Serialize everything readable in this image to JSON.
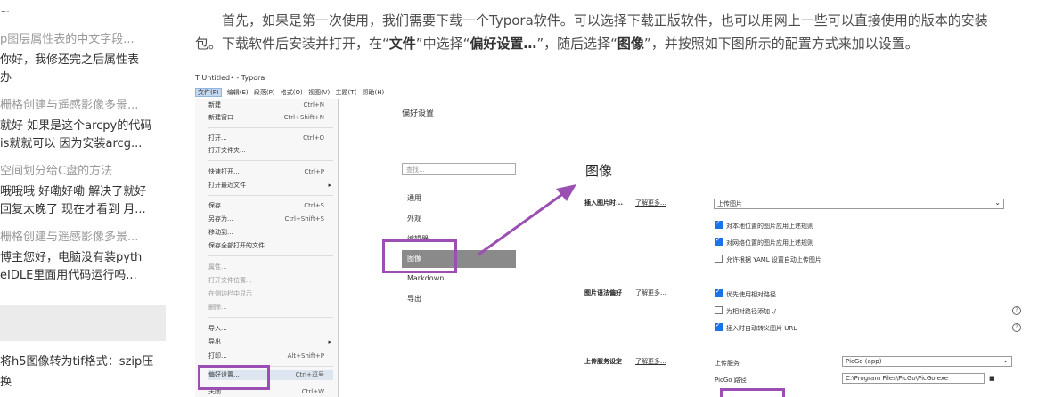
{
  "sidebar": {
    "top_mark": "~",
    "items": [
      {
        "title": "p图层属性表的中文字段...",
        "lines": [
          "你好，我修还完之后属性表",
          "办"
        ]
      },
      {
        "title": "栅格创建与遥感影像多景...",
        "lines": [
          "就好 如果是这个arcpy的代码",
          "is就就可以 因为安装arcg..."
        ]
      },
      {
        "title": "空间划分给C盘的方法",
        "lines": [
          "哦哦哦 好嘞好嘞 解决了就好",
          "回复太晚了 现在才看到 月..."
        ]
      },
      {
        "title": "栅格创建与遥感影像多景...",
        "lines": [
          "博主您好，电脑没有装pyth",
          "eIDLE里面用代码运行吗..."
        ]
      }
    ],
    "bottom_lines": [
      "将h5图像转为tif格式：szip压",
      "换"
    ]
  },
  "article": {
    "line1": "首先，如果是第一次使用，我们需要下载一个Typora软件。可以选择下载正版软件，也可以用网上一些可以直接使用的版本的安装",
    "line2_a": "包。下载软件后安装并打开，在“",
    "line2_b": "文件",
    "line2_c": "”中选择“",
    "line2_d": "偏好设置…",
    "line2_e": "”，随后选择“",
    "line2_f": "图像",
    "line2_g": "”，并按照如下图所示的配置方式来加以设置。"
  },
  "screenshot": {
    "window_title": "T  Untitled• - Typora",
    "menus": [
      "文件(F)",
      "编辑(E)",
      "段落(P)",
      "格式(O)",
      "视图(V)",
      "主题(T)",
      "帮助(H)"
    ],
    "file_menu": [
      {
        "label": "新建",
        "shortcut": "Ctrl+N"
      },
      {
        "label": "新建窗口",
        "shortcut": "Ctrl+Shift+N"
      },
      {
        "label": "打开...",
        "shortcut": "Ctrl+O"
      },
      {
        "label": "打开文件夹...",
        "shortcut": ""
      },
      {
        "label": "快速打开...",
        "shortcut": "Ctrl+P"
      },
      {
        "label": "打开最近文件",
        "shortcut": ""
      },
      {
        "label": "保存",
        "shortcut": "Ctrl+S"
      },
      {
        "label": "另存为...",
        "shortcut": "Ctrl+Shift+S"
      },
      {
        "label": "移动到...",
        "shortcut": ""
      },
      {
        "label": "保存全部打开的文件...",
        "shortcut": ""
      },
      {
        "label": "属性...",
        "shortcut": ""
      },
      {
        "label": "打开文件位置...",
        "shortcut": ""
      },
      {
        "label": "在侧边栏中显示",
        "shortcut": ""
      },
      {
        "label": "删除...",
        "shortcut": ""
      },
      {
        "label": "导入...",
        "shortcut": ""
      },
      {
        "label": "导出",
        "shortcut": ""
      },
      {
        "label": "打印...",
        "shortcut": "Alt+Shift+P"
      },
      {
        "label": "偏好设置...",
        "shortcut": "Ctrl+逗号"
      },
      {
        "label": "关闭",
        "shortcut": "Ctrl+W"
      }
    ],
    "prefs_title": "偏好设置",
    "search_placeholder": "查找...",
    "nav": [
      "通用",
      "外观",
      "编辑器",
      "图像",
      "Markdown",
      "导出"
    ],
    "section_heading": "图像",
    "insert_label": "插入图片时...",
    "learn_more": "了解更多...",
    "insert_select": "上传图片",
    "insert_checks": [
      {
        "label": "对本地位置的图片应用上述规则",
        "checked": true
      },
      {
        "label": "对网络位置的图片应用上述规则",
        "checked": true
      },
      {
        "label": "允许根据 YAML 设置自动上传图片",
        "checked": false
      }
    ],
    "syntax_label": "图片语法偏好",
    "syntax_checks": [
      {
        "label": "优先使用相对路径",
        "checked": true
      },
      {
        "label": "为相对路径添加 ./",
        "checked": false
      },
      {
        "label": "插入时自动转义图片 URL",
        "checked": true
      }
    ],
    "upload_label": "上传服务设定",
    "upload_service_label": "上传服务",
    "upload_service_value": "PicGo (app)",
    "picgo_path_label": "PicGo 路径",
    "picgo_path_value": "C:\\Program Files\\PicGo\\PicGo.exe",
    "help_mark": "?",
    "folder_icon": "■"
  }
}
